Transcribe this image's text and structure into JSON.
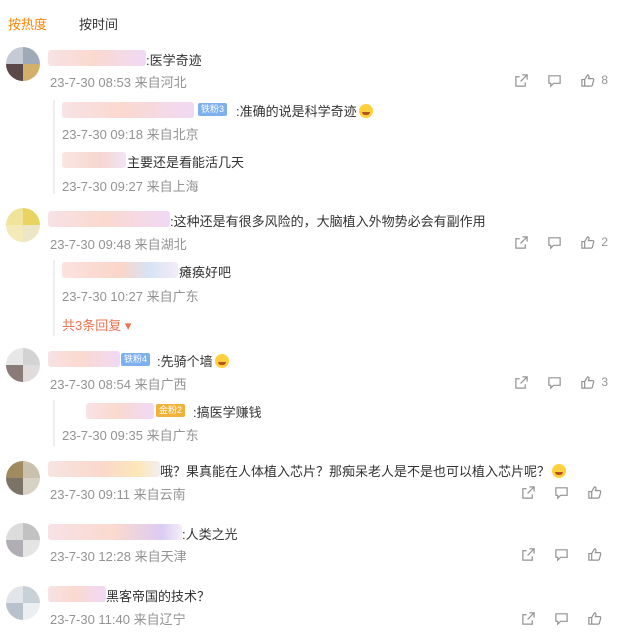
{
  "tabs": {
    "hot": "按热度",
    "time": "按时间"
  },
  "comments": [
    {
      "text": ":医学奇迹",
      "meta": "23-7-30 08:53 来自河北",
      "like_count": "8",
      "replies": [
        {
          "text": ":准确的说是科学奇迹",
          "meta": "23-7-30 09:18 来自北京",
          "badge": "铁粉3"
        },
        {
          "text": "主要还是看能活几天",
          "meta": "23-7-30 09:27 来自上海"
        }
      ]
    },
    {
      "text": ":这种还是有很多风险的，大脑植入外物势必会有副作用",
      "meta": "23-7-30 09:48 来自湖北",
      "like_count": "2",
      "replies": [
        {
          "text": "瘫痪好吧",
          "meta": "23-7-30 10:27 来自广东"
        }
      ],
      "more_replies": "共3条回复"
    },
    {
      "text": ":先骑个墙",
      "meta": "23-7-30 08:54 来自广西",
      "like_count": "3",
      "badge": "铁粉4",
      "replies": [
        {
          "text": ":搞医学赚钱",
          "meta": "23-7-30 09:35 来自广东",
          "badge": "金粉2"
        }
      ]
    },
    {
      "text": "哦？果真能在人体植入芯片？那痴呆老人是不是也可以植入芯片呢？",
      "meta": "23-7-30 09:11 来自云南",
      "like_count": ""
    },
    {
      "text": ":人类之光",
      "meta": "23-7-30 12:28 来自天津",
      "like_count": ""
    },
    {
      "text": "黑客帝国的技术？",
      "meta": "23-7-30 11:40 来自辽宁",
      "like_count": ""
    }
  ],
  "icons": {
    "share": "share-icon",
    "comment": "comment-icon",
    "like": "like-icon"
  },
  "colors": {
    "accent": "#ff8200",
    "meta": "#939393",
    "more": "#eb7350"
  }
}
